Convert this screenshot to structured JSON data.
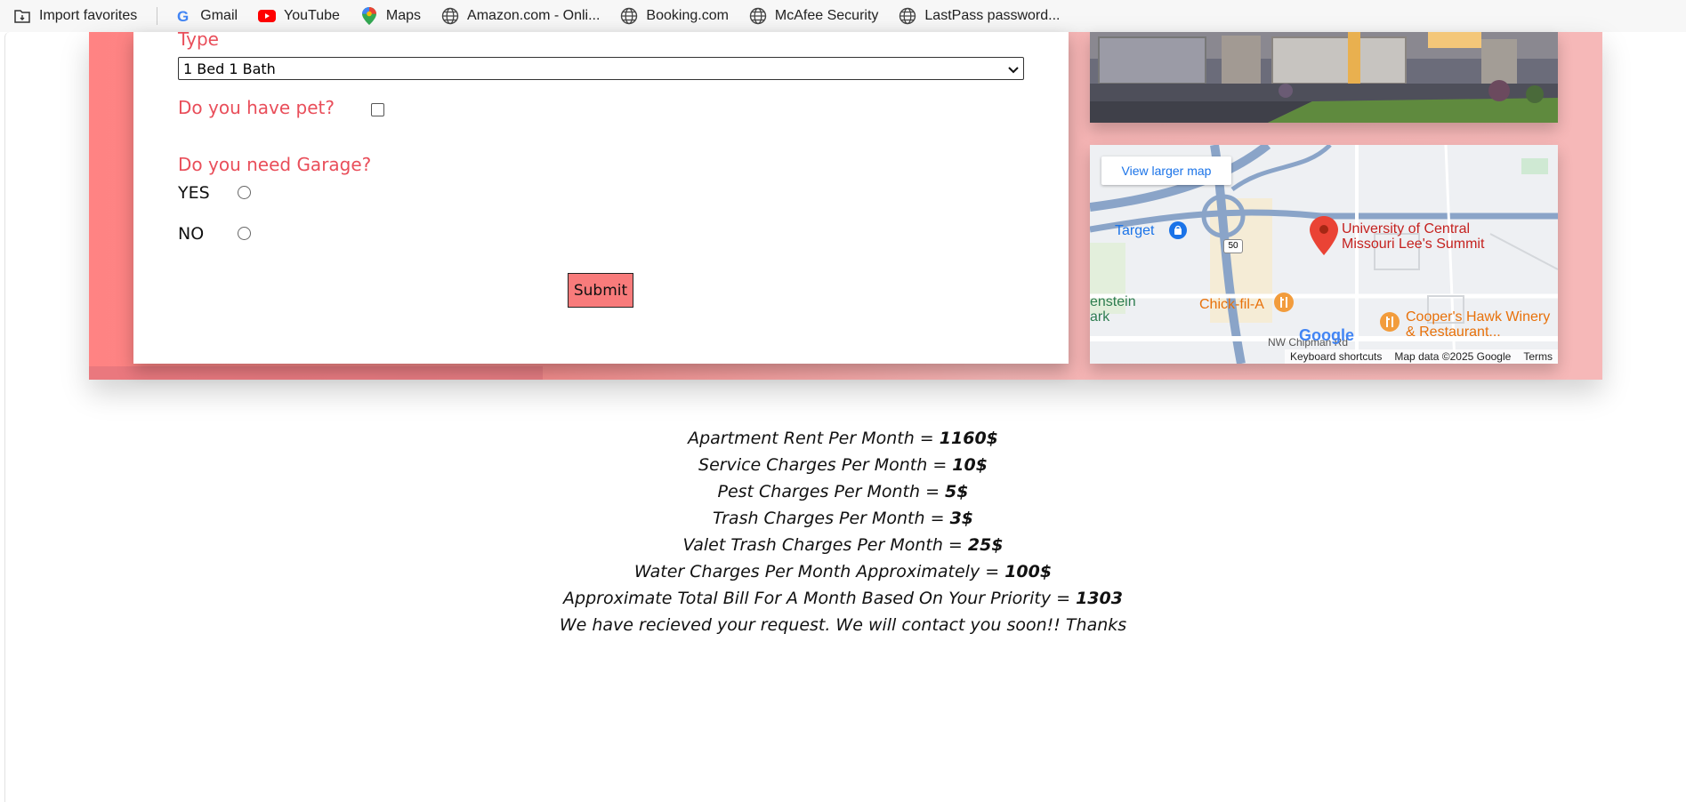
{
  "bookmarks": [
    {
      "label": "Import favorites",
      "icon": "import-icon"
    },
    {
      "label": "Gmail",
      "icon": "google-icon"
    },
    {
      "label": "YouTube",
      "icon": "youtube-icon"
    },
    {
      "label": "Maps",
      "icon": "maps-pin-icon"
    },
    {
      "label": "Amazon.com - Onli...",
      "icon": "globe-icon"
    },
    {
      "label": "Booking.com",
      "icon": "globe-icon"
    },
    {
      "label": "McAfee Security",
      "icon": "globe-icon"
    },
    {
      "label": "LastPass password...",
      "icon": "globe-icon"
    }
  ],
  "form": {
    "type_label": "Type",
    "type_value": "1 Bed 1 Bath",
    "pet_label": "Do you have pet?",
    "garage_label": "Do you need Garage?",
    "yes_label": "YES",
    "no_label": "NO",
    "submit_label": "Submit"
  },
  "map": {
    "view_larger": "View larger map",
    "place_title": "University of Central Missouri Lee's Summit",
    "target": "Target",
    "chick": "Chick-fil-A",
    "coopers": "Cooper's Hawk Winery & Restaurant...",
    "park": "enstein ark",
    "road": "NW Chipman Rd",
    "route": "50",
    "google": "Google",
    "footer": {
      "shortcuts": "Keyboard shortcuts",
      "mapdata": "Map data ©2025 Google",
      "terms": "Terms"
    }
  },
  "results": {
    "rent_label": "Apartment Rent Per Month = ",
    "rent_value": "1160$",
    "service_label": "Service Charges Per Month = ",
    "service_value": "10$",
    "pest_label": "Pest Charges Per Month = ",
    "pest_value": "5$",
    "trash_label": "Trash Charges Per Month = ",
    "trash_value": "3$",
    "valet_label": "Valet Trash Charges Per Month = ",
    "valet_value": "25$",
    "water_label": "Water Charges Per Month Approximately = ",
    "water_value": "100$",
    "total_label": "Approximate Total Bill For A Month Based On Your Priority = ",
    "total_value": "1303",
    "message": "We have recieved your request. We will contact you soon!! Thanks"
  },
  "colors": {
    "accent_label": "#e94e5a",
    "submit_bg": "#f87b7b",
    "band": "#ff8383"
  }
}
